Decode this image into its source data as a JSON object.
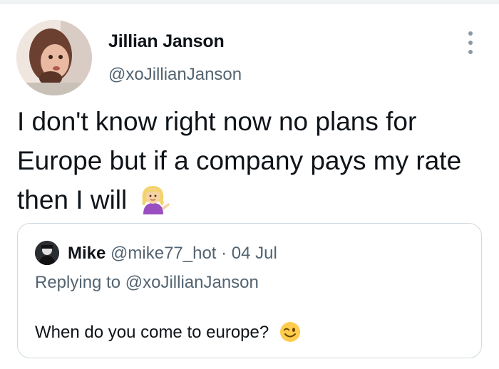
{
  "tweet": {
    "author_name": "Jillian Janson",
    "author_handle": "@xoJillianJanson",
    "text": "I don't know right now no plans for Europe but if a company pays my rate then I will",
    "emoji_icon": "woman-tipping-hand-icon"
  },
  "quoted": {
    "author_name": "Mike",
    "meta": "@mike77_hot · 04 Jul",
    "replying_to": "Replying to @xoJillianJanson",
    "text": "When do you come to europe?",
    "emoji_icon": "winking-face-icon"
  },
  "icons": {
    "more": "more-vertical-icon"
  },
  "colors": {
    "text": "#0f1419",
    "secondary": "#536471",
    "border": "#cfd9de"
  }
}
